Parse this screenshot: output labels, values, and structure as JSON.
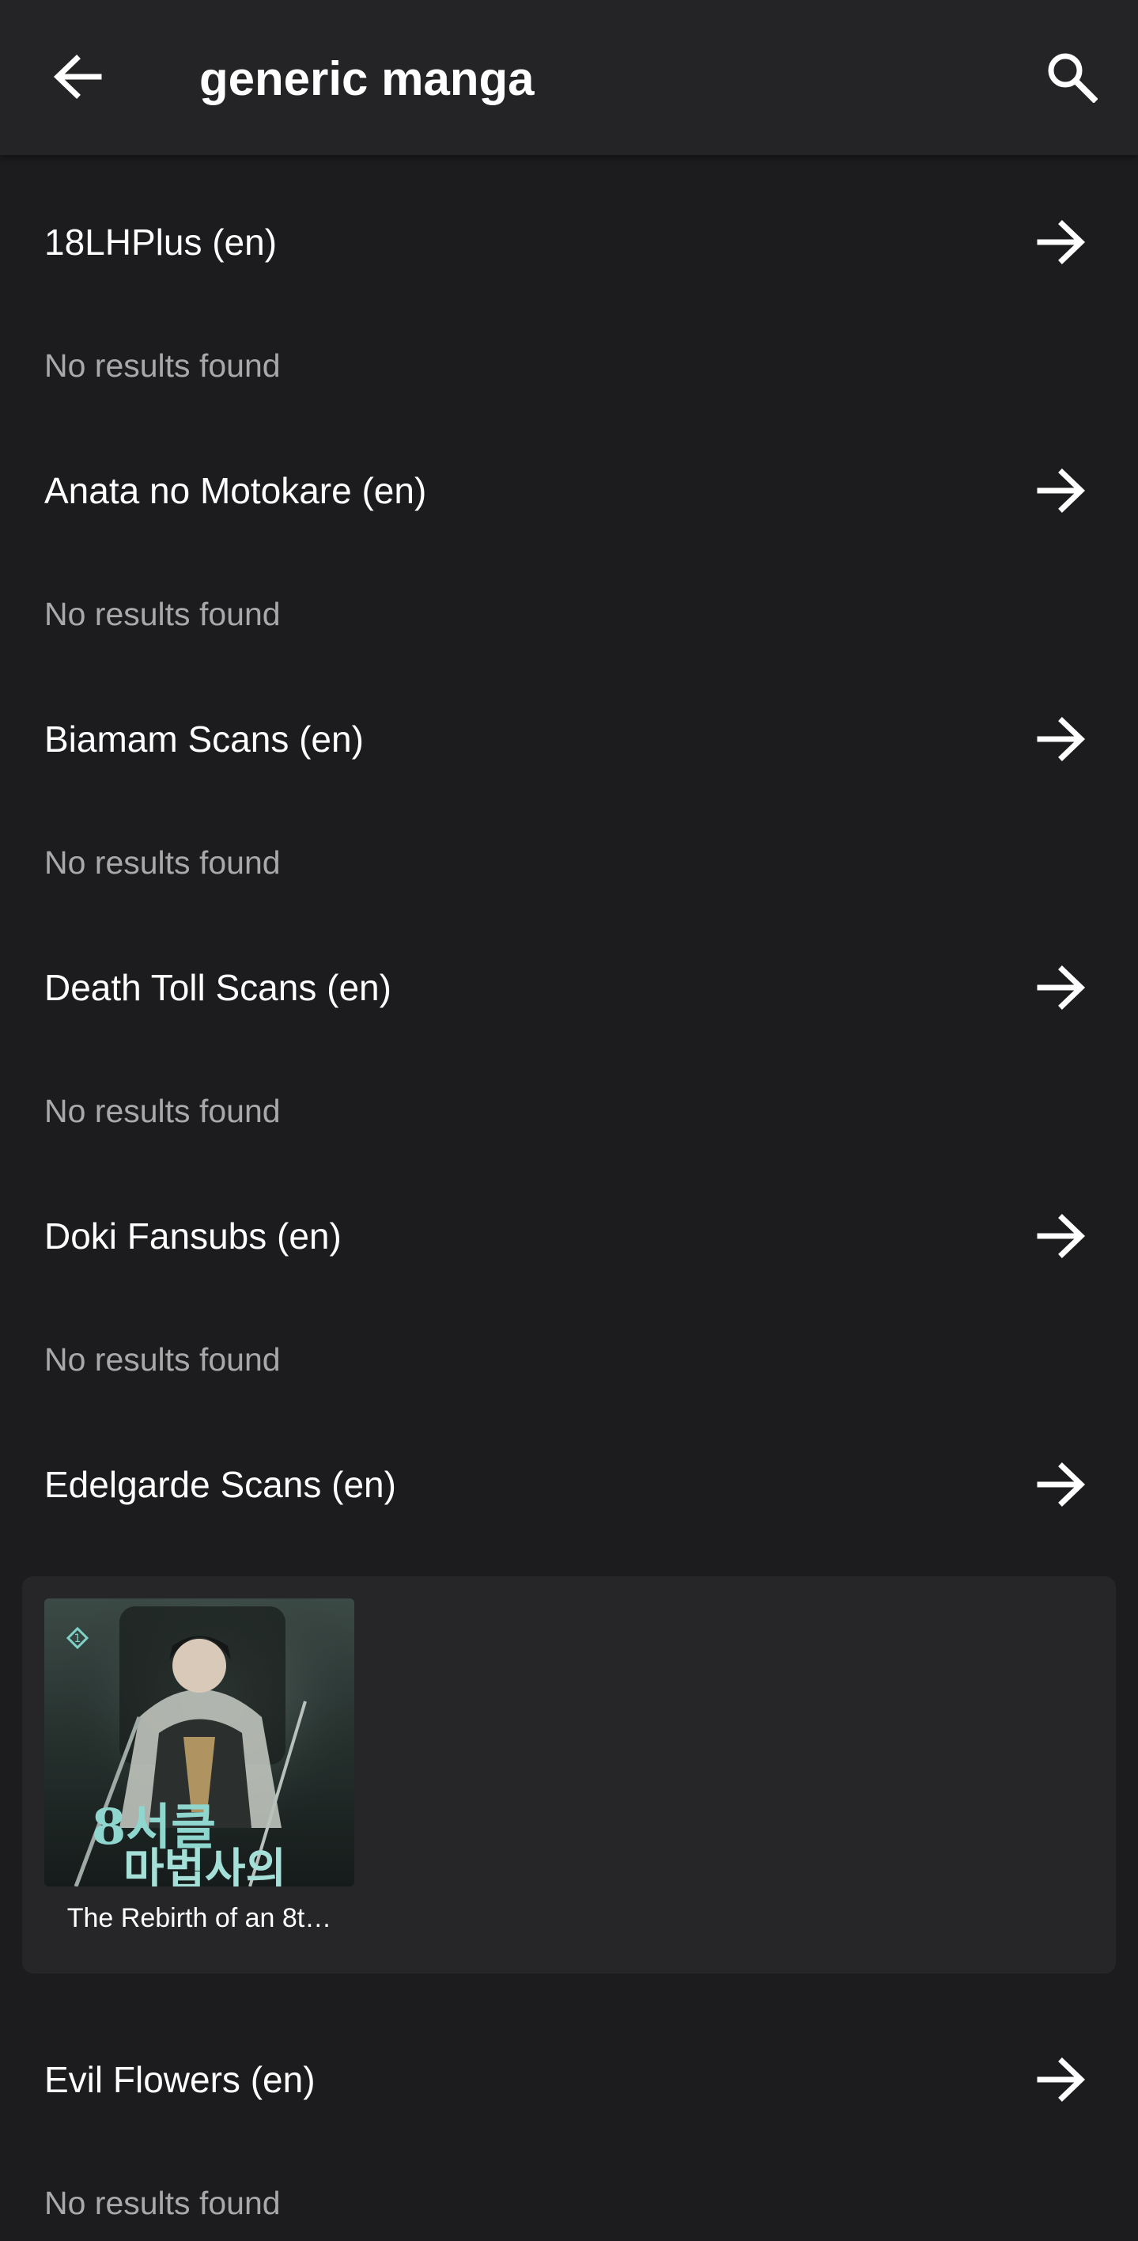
{
  "header": {
    "title": "generic manga",
    "back_icon": "arrow-back-icon",
    "search_icon": "search-icon"
  },
  "sources": [
    {
      "name": "18LHPlus (en)",
      "status": "No results found"
    },
    {
      "name": "Anata no Motokare (en)",
      "status": "No results found"
    },
    {
      "name": "Biamam Scans (en)",
      "status": "No results found"
    },
    {
      "name": "Death Toll Scans (en)",
      "status": "No results found"
    },
    {
      "name": "Doki Fansubs (en)",
      "status": "No results found"
    },
    {
      "name": "Edelgarde Scans (en)",
      "results": [
        {
          "title": "The Rebirth of an 8t…",
          "cover_text_top": "8서클",
          "cover_text_bottom": "마법사의"
        }
      ]
    },
    {
      "name": "Evil Flowers (en)",
      "status": "No results found"
    }
  ],
  "colors": {
    "background": "#1c1c1e",
    "topbar": "#242426",
    "card": "#262628",
    "secondary_text": "#a9a9ab",
    "primary_text": "#ffffff"
  }
}
